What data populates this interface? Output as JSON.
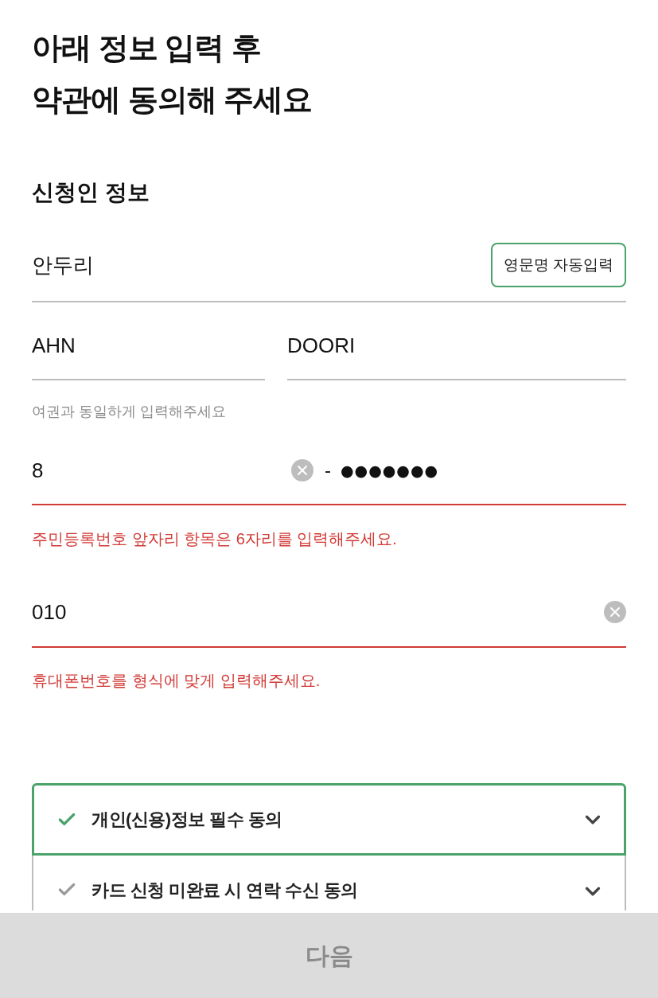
{
  "heading": {
    "lines": [
      "아래 정보 입력 후",
      "약관에 동의해 주세요"
    ]
  },
  "applicant": {
    "section_title": "신청인 정보",
    "name_field": {
      "value": "안두리",
      "invalid": false,
      "button": "영문명 자동입력"
    },
    "english_name": {
      "surname": {
        "value": "AHN",
        "invalid": false
      },
      "given_name": {
        "value": "DOORI",
        "invalid": false
      },
      "hint": "여권과 동일하게 입력해주세요"
    },
    "rrn": {
      "front": {
        "value": "8",
        "clearable": true
      },
      "separator": "-",
      "back_masked": "●●●●●●●",
      "invalid": true,
      "error": "주민등록번호 앞자리 항목은 6자리를 입력해주세요."
    },
    "phone": {
      "value": "010",
      "clearable": true,
      "invalid": true,
      "error": "휴대폰번호를 형식에 맞게 입력해주세요."
    }
  },
  "agreements": [
    {
      "label": "개인(신용)정보 필수 동의",
      "checked": true
    },
    {
      "label": "카드 신청 미완료 시 연락 수신 동의",
      "checked": false
    }
  ],
  "next_button": {
    "label": "다음",
    "disabled": true
  }
}
